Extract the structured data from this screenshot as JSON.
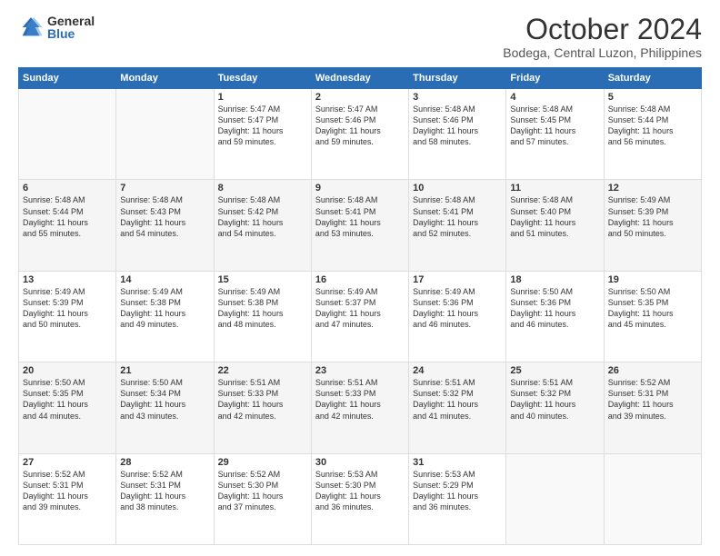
{
  "logo": {
    "general": "General",
    "blue": "Blue"
  },
  "header": {
    "month": "October 2024",
    "location": "Bodega, Central Luzon, Philippines"
  },
  "weekdays": [
    "Sunday",
    "Monday",
    "Tuesday",
    "Wednesday",
    "Thursday",
    "Friday",
    "Saturday"
  ],
  "weeks": [
    [
      {
        "day": "",
        "info": ""
      },
      {
        "day": "",
        "info": ""
      },
      {
        "day": "1",
        "info": "Sunrise: 5:47 AM\nSunset: 5:47 PM\nDaylight: 11 hours\nand 59 minutes."
      },
      {
        "day": "2",
        "info": "Sunrise: 5:47 AM\nSunset: 5:46 PM\nDaylight: 11 hours\nand 59 minutes."
      },
      {
        "day": "3",
        "info": "Sunrise: 5:48 AM\nSunset: 5:46 PM\nDaylight: 11 hours\nand 58 minutes."
      },
      {
        "day": "4",
        "info": "Sunrise: 5:48 AM\nSunset: 5:45 PM\nDaylight: 11 hours\nand 57 minutes."
      },
      {
        "day": "5",
        "info": "Sunrise: 5:48 AM\nSunset: 5:44 PM\nDaylight: 11 hours\nand 56 minutes."
      }
    ],
    [
      {
        "day": "6",
        "info": "Sunrise: 5:48 AM\nSunset: 5:44 PM\nDaylight: 11 hours\nand 55 minutes."
      },
      {
        "day": "7",
        "info": "Sunrise: 5:48 AM\nSunset: 5:43 PM\nDaylight: 11 hours\nand 54 minutes."
      },
      {
        "day": "8",
        "info": "Sunrise: 5:48 AM\nSunset: 5:42 PM\nDaylight: 11 hours\nand 54 minutes."
      },
      {
        "day": "9",
        "info": "Sunrise: 5:48 AM\nSunset: 5:41 PM\nDaylight: 11 hours\nand 53 minutes."
      },
      {
        "day": "10",
        "info": "Sunrise: 5:48 AM\nSunset: 5:41 PM\nDaylight: 11 hours\nand 52 minutes."
      },
      {
        "day": "11",
        "info": "Sunrise: 5:48 AM\nSunset: 5:40 PM\nDaylight: 11 hours\nand 51 minutes."
      },
      {
        "day": "12",
        "info": "Sunrise: 5:49 AM\nSunset: 5:39 PM\nDaylight: 11 hours\nand 50 minutes."
      }
    ],
    [
      {
        "day": "13",
        "info": "Sunrise: 5:49 AM\nSunset: 5:39 PM\nDaylight: 11 hours\nand 50 minutes."
      },
      {
        "day": "14",
        "info": "Sunrise: 5:49 AM\nSunset: 5:38 PM\nDaylight: 11 hours\nand 49 minutes."
      },
      {
        "day": "15",
        "info": "Sunrise: 5:49 AM\nSunset: 5:38 PM\nDaylight: 11 hours\nand 48 minutes."
      },
      {
        "day": "16",
        "info": "Sunrise: 5:49 AM\nSunset: 5:37 PM\nDaylight: 11 hours\nand 47 minutes."
      },
      {
        "day": "17",
        "info": "Sunrise: 5:49 AM\nSunset: 5:36 PM\nDaylight: 11 hours\nand 46 minutes."
      },
      {
        "day": "18",
        "info": "Sunrise: 5:50 AM\nSunset: 5:36 PM\nDaylight: 11 hours\nand 46 minutes."
      },
      {
        "day": "19",
        "info": "Sunrise: 5:50 AM\nSunset: 5:35 PM\nDaylight: 11 hours\nand 45 minutes."
      }
    ],
    [
      {
        "day": "20",
        "info": "Sunrise: 5:50 AM\nSunset: 5:35 PM\nDaylight: 11 hours\nand 44 minutes."
      },
      {
        "day": "21",
        "info": "Sunrise: 5:50 AM\nSunset: 5:34 PM\nDaylight: 11 hours\nand 43 minutes."
      },
      {
        "day": "22",
        "info": "Sunrise: 5:51 AM\nSunset: 5:33 PM\nDaylight: 11 hours\nand 42 minutes."
      },
      {
        "day": "23",
        "info": "Sunrise: 5:51 AM\nSunset: 5:33 PM\nDaylight: 11 hours\nand 42 minutes."
      },
      {
        "day": "24",
        "info": "Sunrise: 5:51 AM\nSunset: 5:32 PM\nDaylight: 11 hours\nand 41 minutes."
      },
      {
        "day": "25",
        "info": "Sunrise: 5:51 AM\nSunset: 5:32 PM\nDaylight: 11 hours\nand 40 minutes."
      },
      {
        "day": "26",
        "info": "Sunrise: 5:52 AM\nSunset: 5:31 PM\nDaylight: 11 hours\nand 39 minutes."
      }
    ],
    [
      {
        "day": "27",
        "info": "Sunrise: 5:52 AM\nSunset: 5:31 PM\nDaylight: 11 hours\nand 39 minutes."
      },
      {
        "day": "28",
        "info": "Sunrise: 5:52 AM\nSunset: 5:31 PM\nDaylight: 11 hours\nand 38 minutes."
      },
      {
        "day": "29",
        "info": "Sunrise: 5:52 AM\nSunset: 5:30 PM\nDaylight: 11 hours\nand 37 minutes."
      },
      {
        "day": "30",
        "info": "Sunrise: 5:53 AM\nSunset: 5:30 PM\nDaylight: 11 hours\nand 36 minutes."
      },
      {
        "day": "31",
        "info": "Sunrise: 5:53 AM\nSunset: 5:29 PM\nDaylight: 11 hours\nand 36 minutes."
      },
      {
        "day": "",
        "info": ""
      },
      {
        "day": "",
        "info": ""
      }
    ]
  ]
}
